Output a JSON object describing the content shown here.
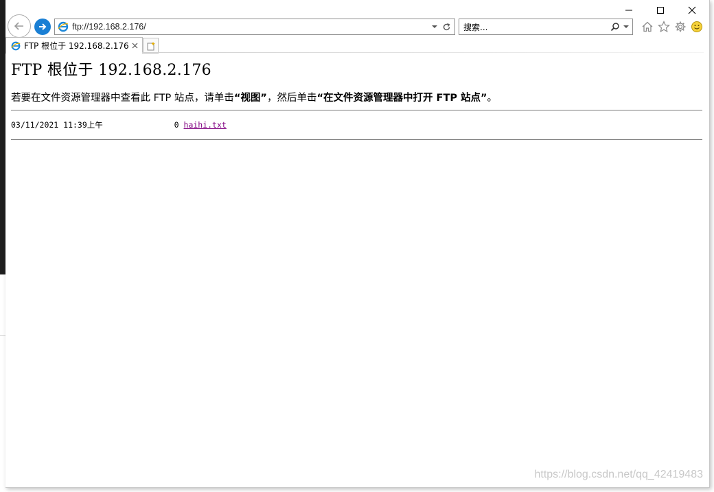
{
  "browser": {
    "controls": {
      "minimize": "—",
      "maximize": "☐",
      "close": "✕"
    },
    "address": "ftp://192.168.2.176/",
    "search_placeholder": "搜索...",
    "tab": {
      "title": "FTP 根位于 192.168.2.176"
    },
    "icons": {
      "back": "back-arrow-icon",
      "forward": "forward-arrow-icon",
      "home": "home-icon",
      "favorites": "star-icon",
      "tools": "gear-icon",
      "feedback": "smiley-icon"
    },
    "accent_color": "#1a7fd4"
  },
  "page": {
    "title": "FTP 根位于 192.168.2.176",
    "instruction": {
      "prefix": "若要在文件资源管理器中查看此 FTP 站点，请单击",
      "view_label": "“视图”",
      "middle": "，然后单击",
      "open_label": "“在文件资源管理器中打开 FTP 站点”",
      "suffix": "。"
    },
    "files": [
      {
        "date": "03/11/2021 11:39上午",
        "size": "0",
        "name": "haihi.txt"
      }
    ],
    "link_color": "#800080"
  },
  "watermark": "https://blog.csdn.net/qq_42419483"
}
